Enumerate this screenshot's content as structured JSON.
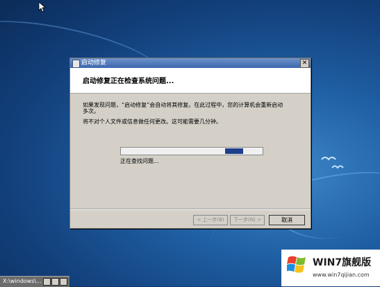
{
  "dialog": {
    "title": "启动修复",
    "close_glyph": "✕",
    "header": "启动修复正在检查系统问题...",
    "para1_line1": "如果发现问题，“启动修复”会自动将其修复。在此过程中，您的计算机会重新启动",
    "para1_line2": "多次。",
    "para2": "将不对个人文件或信息做任何更改。这可能需要几分钟。",
    "status": "正在查找问题...",
    "progress_fraction": 0.1,
    "buttons": {
      "back": "< 上一步(B)",
      "next": "下一步(N) >",
      "cancel": "取消"
    }
  },
  "taskbar": {
    "item_label": "X:\\windows\\...",
    "item_icon": "cmd-icon"
  },
  "logo": {
    "title": "WIN7旗舰版",
    "url": "www.win7qijian.com"
  },
  "colors": {
    "dialog_bg": "#d4d0c8",
    "titlebar": "#3b66ad",
    "desktop": "#1f5fa3"
  }
}
